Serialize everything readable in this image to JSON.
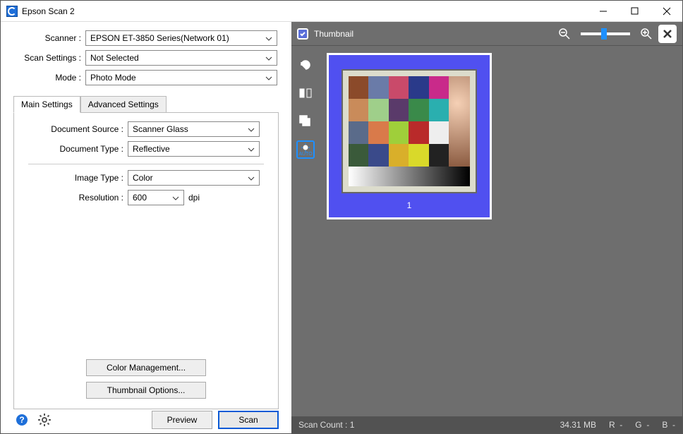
{
  "window": {
    "title": "Epson Scan 2"
  },
  "form": {
    "scanner_label": "Scanner :",
    "scanner_value": "EPSON ET-3850 Series(Network 01)",
    "scan_settings_label": "Scan Settings :",
    "scan_settings_value": "Not Selected",
    "mode_label": "Mode :",
    "mode_value": "Photo Mode"
  },
  "tabs": {
    "main": "Main Settings",
    "advanced": "Advanced Settings"
  },
  "settings": {
    "doc_source_label": "Document Source :",
    "doc_source_value": "Scanner Glass",
    "doc_type_label": "Document Type :",
    "doc_type_value": "Reflective",
    "image_type_label": "Image Type :",
    "image_type_value": "Color",
    "resolution_label": "Resolution :",
    "resolution_value": "600",
    "resolution_unit": "dpi"
  },
  "buttons": {
    "color_mgmt": "Color Management...",
    "thumb_opts": "Thumbnail Options...",
    "preview": "Preview",
    "scan": "Scan"
  },
  "preview": {
    "thumbnail_label": "Thumbnail",
    "item_label": "1"
  },
  "status": {
    "count_label": "Scan Count :",
    "count_value": "1",
    "size": "34.31 MB",
    "r_label": "R",
    "r_value": "-",
    "g_label": "G",
    "g_value": "-",
    "b_label": "B",
    "b_value": "-"
  },
  "colors": {
    "accent": "#0a5ad6",
    "preview_bg": "#6e6e6e",
    "thumb_bg": "#5050f0"
  }
}
